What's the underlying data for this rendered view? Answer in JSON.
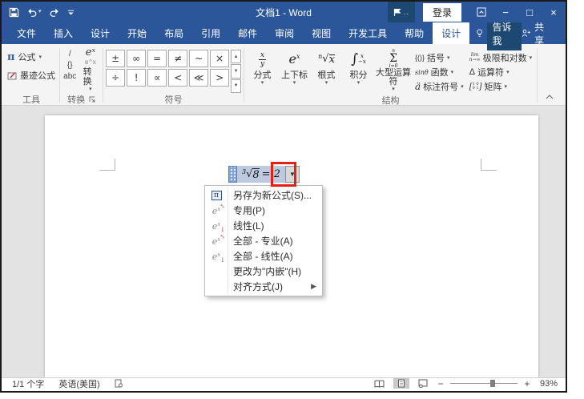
{
  "titlebar": {
    "title": "文档1 - Word",
    "sign_in": "登录"
  },
  "tabs": [
    "文件",
    "插入",
    "设计",
    "开始",
    "布局",
    "引用",
    "邮件",
    "审阅",
    "视图",
    "开发工具",
    "帮助",
    "设计"
  ],
  "tell_me": "告诉我",
  "share": "共享",
  "ribbon": {
    "tools": {
      "label": "工具",
      "pi": "π",
      "equation": "公式",
      "ink": "墨迹公式"
    },
    "conversion": {
      "label": "转换",
      "mini": [
        "/",
        "{}",
        "abc"
      ],
      "icon_top": "eˣ",
      "icon_sub": "e^x",
      "button": "转换"
    },
    "symbols": {
      "label": "符号",
      "row1": [
        "±",
        "∞",
        "=",
        "≠",
        "~",
        "×"
      ],
      "row2": [
        "÷",
        "!",
        "∝",
        "<",
        "≪",
        ">"
      ]
    },
    "structures": {
      "label": "结构",
      "fraction": {
        "label": "分式",
        "num": "x",
        "den": "y"
      },
      "script": {
        "label": "上下标",
        "base": "e",
        "sup": "x"
      },
      "radical": {
        "label": "根式",
        "index": "n",
        "sign": "√",
        "radicand": "x"
      },
      "integral": {
        "label": "积分",
        "sign": "∫",
        "sup": "x",
        "sub": "−x"
      },
      "large_operator": {
        "label": "大型运算符",
        "top": "n",
        "sign": "Σ",
        "bottom": "i=0"
      },
      "bracket": {
        "label": "括号",
        "icon": "{()}"
      },
      "function": {
        "label": "函数",
        "icon": "sinθ"
      },
      "accent": {
        "label": "标注符号",
        "icon": "ä"
      },
      "limit": {
        "label": "极限和对数",
        "icon_top": "lim",
        "icon_bottom": "n→∞"
      },
      "operator": {
        "label": "运算符",
        "icon": "Δ"
      },
      "matrix": {
        "label": "矩阵",
        "row1": "1 0",
        "row2": "0 1"
      }
    }
  },
  "document": {
    "equation": {
      "index": "3",
      "sign": "√",
      "radicand": "8",
      "rhs": "= 2"
    },
    "menu": {
      "items": [
        {
          "label": "另存为新公式(S)...",
          "icon": "save-as-new-equation-icon"
        },
        {
          "label": "专用(P)",
          "icon": "professional-icon"
        },
        {
          "label": "线性(L)",
          "icon": "linear-icon"
        },
        {
          "label": "全部 - 专业(A)",
          "icon": "all-professional-icon"
        },
        {
          "label": "全部 - 线性(A)",
          "icon": "all-linear-icon"
        },
        {
          "label": "更改为\"内嵌\"(H)",
          "icon": ""
        },
        {
          "label": "对齐方式(J)",
          "icon": "",
          "submenu": true
        }
      ]
    }
  },
  "statusbar": {
    "word_count": "1/1 个字",
    "language": "英语(美国)",
    "minus": "−",
    "plus": "+",
    "zoom": "93%"
  }
}
